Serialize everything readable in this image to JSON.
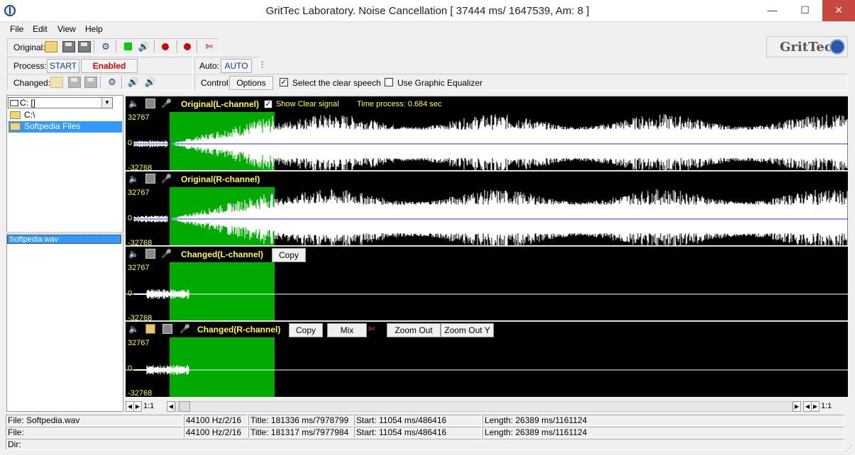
{
  "window": {
    "title": "GritTec Laboratory. Noise Cancellation [ 37444 ms/ 1647539, Am:  8 ]",
    "minimize": "—",
    "maximize": "☐",
    "close": "✕"
  },
  "menu": [
    "File",
    "Edit",
    "View",
    "Help"
  ],
  "toolbar": {
    "original_label": "Original:",
    "process_label": "Process:",
    "start": "START",
    "enabled": "Enabled",
    "auto_label": "Auto:",
    "auto": "AUTO",
    "changed_label": "Changed:",
    "control_label": "Control:",
    "options": "Options",
    "select_clear_speech": "Select the clear speech",
    "select_clear_speech_checked": true,
    "use_graphic_equalizer": "Use Graphic Equalizer",
    "use_graphic_equalizer_checked": false
  },
  "logo": "GritTec",
  "left": {
    "drive": "C: []",
    "dirs": [
      "C:\\",
      "Softpedia Files"
    ],
    "file": "Softpedia.wav"
  },
  "panels": [
    {
      "title": "Original(L-channel)",
      "show_clear": "Show Clear signal",
      "show_clear_checked": true,
      "time": "Time process: 0.684 sec",
      "ymax": "32767",
      "yzero": "0",
      "ymin": "-32768"
    },
    {
      "title": "Original(R-channel)",
      "ymax": "32767",
      "yzero": "0",
      "ymin": "-32768"
    },
    {
      "title": "Changed(L-channel)",
      "copy": "Copy",
      "ymax": "32767",
      "yzero": "0",
      "ymin": "-32768"
    },
    {
      "title": "Changed(R-channel)",
      "copy": "Copy",
      "mix": "Mix",
      "zoom_out": "Zoom Out",
      "zoom_out_y": "Zoom Out Y",
      "ymax": "32767",
      "yzero": "0",
      "ymin": "-32768"
    }
  ],
  "scroll": {
    "left_zoom": "1:1",
    "right_zoom": "1:1"
  },
  "status": {
    "row1": {
      "file": "File: Softpedia.wav",
      "fmt": "44100 Hz/2/16",
      "title": "Title: 181336 ms/7978799",
      "start": "Start: 11054 ms/486416",
      "length": "Length: 26389 ms/1161124"
    },
    "row2": {
      "file": "File:",
      "fmt": "44100 Hz/2/16",
      "title": "Title: 181317 ms/7977984",
      "start": "Start: 11054 ms/486416",
      "length": "Length: 26389 ms/1161124"
    },
    "row3": {
      "dir": "Dir:"
    }
  },
  "colors": {
    "highlight": "#00aa00",
    "wave_original": "#ffffff",
    "axis": "#2233dd",
    "label": "#ffff33"
  }
}
